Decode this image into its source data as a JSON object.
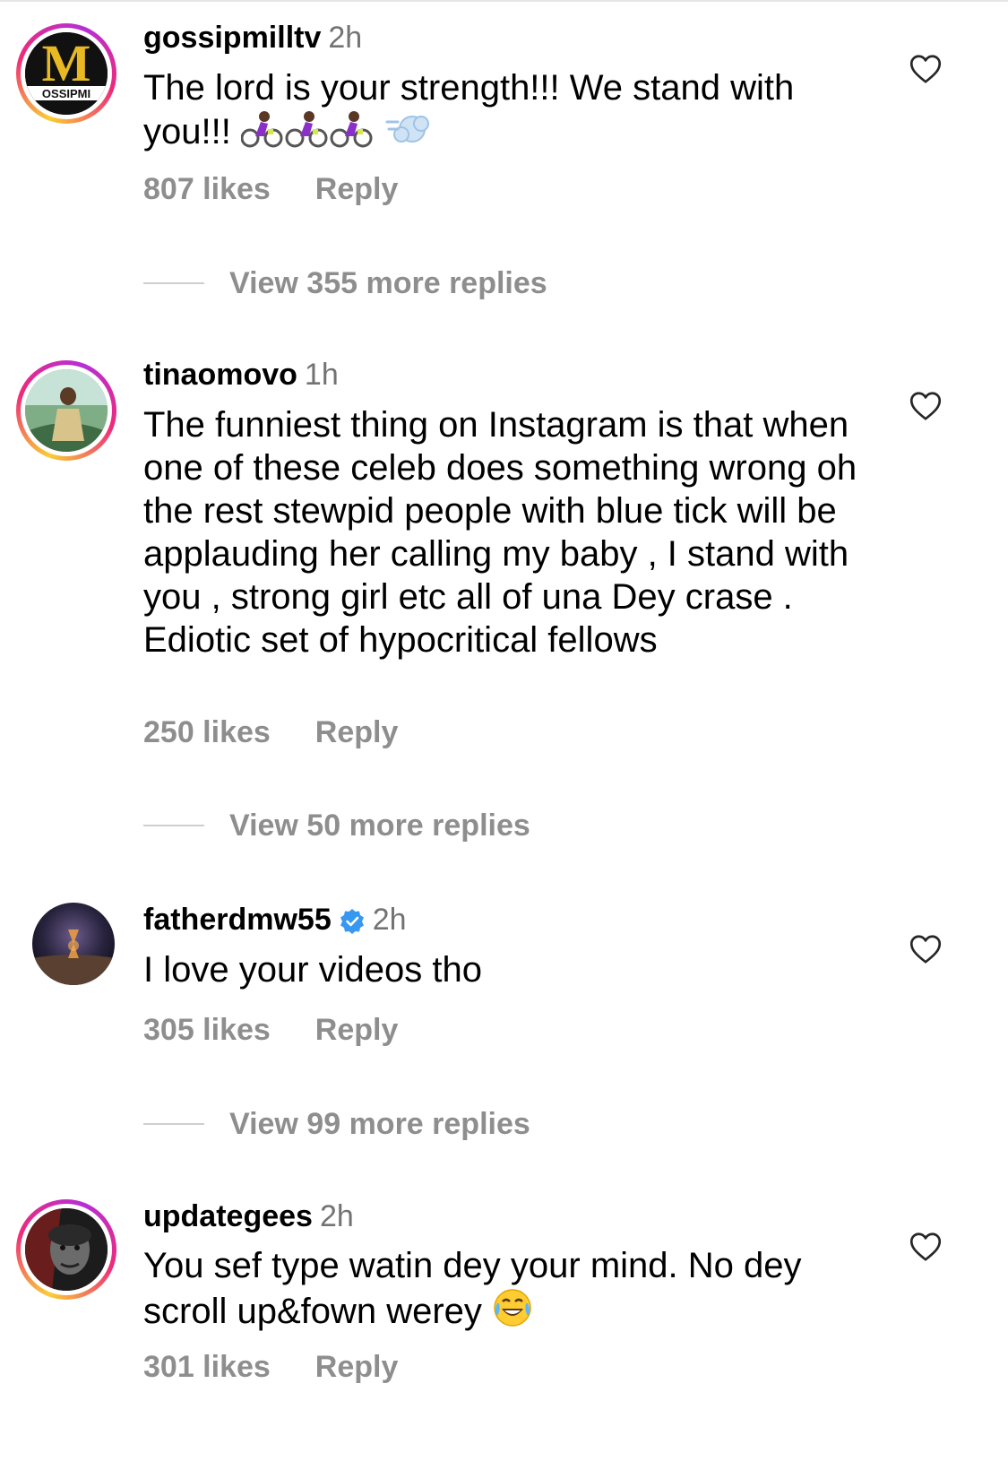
{
  "comments": [
    {
      "username": "gossipmilltv",
      "time": "2h",
      "text": "The lord is your strength!!! We stand with you!!!",
      "likes": "807 likes",
      "reply": "Reply",
      "more_replies": "View 355 more replies",
      "avatar_text": "M",
      "avatar_caption": "OSSIPMI"
    },
    {
      "username": "tinaomovo",
      "time": "1h",
      "text": "The funniest thing on Instagram is that when one of these celeb does something wrong oh the rest stewpid people with blue tick will be applauding her calling my baby , I stand with you , strong girl etc all of una Dey crase . Ediotic set of hypocritical fellows",
      "likes": "250 likes",
      "reply": "Reply",
      "more_replies": "View 50 more replies"
    },
    {
      "username": "fatherdmw55",
      "time": "2h",
      "verified": true,
      "text": "I love your videos tho",
      "likes": "305 likes",
      "reply": "Reply",
      "more_replies": "View 99 more replies"
    },
    {
      "username": "updategees",
      "time": "2h",
      "text": "You sef type watin dey your mind.  No dey scroll up&fown werey",
      "likes": "301 likes",
      "reply": "Reply"
    }
  ],
  "icons": {
    "heart": "heart-outline-icon",
    "verified": "verified-badge-icon",
    "cyclist": "person-biking-emoji",
    "dash": "dash-emoji",
    "laugh": "tears-of-joy-emoji"
  },
  "colors": {
    "secondary_text": "#8e8e8e",
    "time_text": "#737373",
    "verified_blue": "#3897f0"
  }
}
